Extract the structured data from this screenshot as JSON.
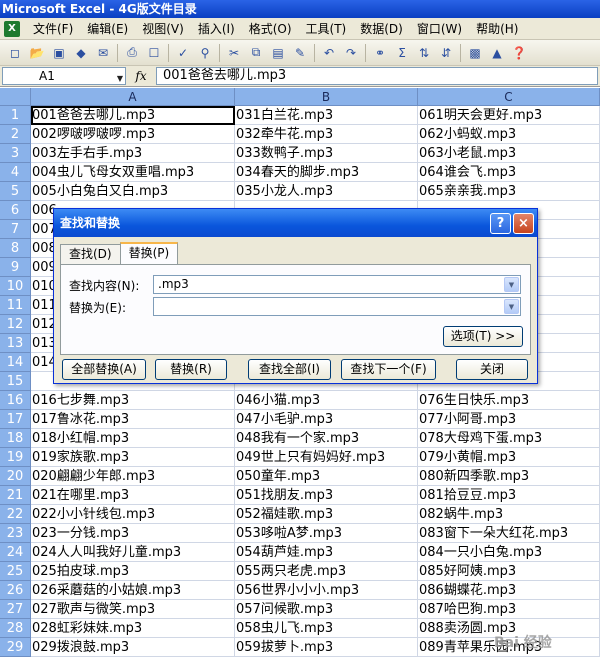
{
  "window": {
    "title": "Microsoft Excel - 4G版文件目录"
  },
  "menu": [
    "文件(F)",
    "编辑(E)",
    "视图(V)",
    "插入(I)",
    "格式(O)",
    "工具(T)",
    "数据(D)",
    "窗口(W)",
    "帮助(H)"
  ],
  "formula_bar": {
    "name_box": "A1",
    "fx_label": "fx",
    "content": "001爸爸去哪儿.mp3"
  },
  "columns": [
    "A",
    "B",
    "C"
  ],
  "rows": [
    {
      "n": "1",
      "a": "001爸爸去哪儿.mp3",
      "b": "031白兰花.mp3",
      "c": "061明天会更好.mp3"
    },
    {
      "n": "2",
      "a": "002啰啵啰啵啰.mp3",
      "b": "032牵牛花.mp3",
      "c": "062小蚂蚁.mp3"
    },
    {
      "n": "3",
      "a": "003左手右手.mp3",
      "b": "033数鸭子.mp3",
      "c": "063小老鼠.mp3"
    },
    {
      "n": "4",
      "a": "004虫儿飞母女双重唱.mp3",
      "b": "034春天的脚步.mp3",
      "c": "064谁会飞.mp3"
    },
    {
      "n": "5",
      "a": "005小白兔白又白.mp3",
      "b": "035小龙人.mp3",
      "c": "065亲亲我.mp3"
    },
    {
      "n": "6",
      "a": "006",
      "b": "",
      "c": ""
    },
    {
      "n": "7",
      "a": "007",
      "b": "",
      "c": ""
    },
    {
      "n": "8",
      "a": "008",
      "b": "",
      "c": ""
    },
    {
      "n": "9",
      "a": "009",
      "b": "",
      "c": ""
    },
    {
      "n": "10",
      "a": "010",
      "b": "",
      "c": ""
    },
    {
      "n": "11",
      "a": "011",
      "b": "",
      "c": ""
    },
    {
      "n": "12",
      "a": "012",
      "b": "",
      "c": ""
    },
    {
      "n": "13",
      "a": "013",
      "b": "",
      "c": ""
    },
    {
      "n": "14",
      "a": "014",
      "b": "",
      "c": ""
    },
    {
      "n": "15",
      "a": "",
      "b": "",
      "c": ""
    },
    {
      "n": "16",
      "a": "016七步舞.mp3",
      "b": "046小猫.mp3",
      "c": "076生日快乐.mp3"
    },
    {
      "n": "17",
      "a": "017鲁冰花.mp3",
      "b": "047小毛驴.mp3",
      "c": "077小阿哥.mp3"
    },
    {
      "n": "18",
      "a": "018小红帽.mp3",
      "b": "048我有一个家.mp3",
      "c": "078大母鸡下蛋.mp3"
    },
    {
      "n": "19",
      "a": "019家族歌.mp3",
      "b": "049世上只有妈妈好.mp3",
      "c": "079小黄帽.mp3"
    },
    {
      "n": "20",
      "a": "020翩翩少年郎.mp3",
      "b": "050童年.mp3",
      "c": "080新四季歌.mp3"
    },
    {
      "n": "21",
      "a": "021在哪里.mp3",
      "b": "051找朋友.mp3",
      "c": "081拾豆豆.mp3"
    },
    {
      "n": "22",
      "a": "022小小针线包.mp3",
      "b": "052福娃歌.mp3",
      "c": "082蜗牛.mp3"
    },
    {
      "n": "23",
      "a": "023一分钱.mp3",
      "b": "053哆啦A梦.mp3",
      "c": "083窗下一朵大红花.mp3"
    },
    {
      "n": "24",
      "a": "024人人叫我好儿童.mp3",
      "b": "054葫芦娃.mp3",
      "c": "084一只小白兔.mp3"
    },
    {
      "n": "25",
      "a": "025拍皮球.mp3",
      "b": "055两只老虎.mp3",
      "c": "085好阿姨.mp3"
    },
    {
      "n": "26",
      "a": "026采蘑菇的小姑娘.mp3",
      "b": "056世界小小小.mp3",
      "c": "086蝴蝶花.mp3"
    },
    {
      "n": "27",
      "a": "027歌声与微笑.mp3",
      "b": "057问候歌.mp3",
      "c": "087哈巴狗.mp3"
    },
    {
      "n": "28",
      "a": "028虹彩妹妹.mp3",
      "b": "058虫儿飞.mp3",
      "c": "088卖汤圆.mp3"
    },
    {
      "n": "29",
      "a": "029拨浪鼓.mp3",
      "b": "059拔萝卜.mp3",
      "c": "089青苹果乐园.mp3"
    }
  ],
  "dialog": {
    "title": "查找和替换",
    "help": "?",
    "close": "×",
    "tabs": [
      "查找(D)",
      "替换(P)"
    ],
    "find_label": "查找内容(N):",
    "find_value": ".mp3",
    "replace_label": "替换为(E):",
    "replace_value": "",
    "options_button": "选项(T) >>",
    "buttons": [
      "全部替换(A)",
      "替换(R)",
      "查找全部(I)",
      "查找下一个(F)",
      "关闭"
    ]
  },
  "watermark": "Bai 经验"
}
